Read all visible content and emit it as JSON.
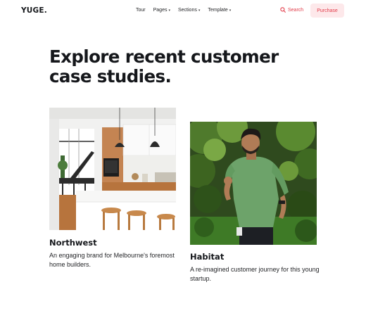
{
  "nav": {
    "logo": "YUGE.",
    "menu": [
      {
        "label": "Tour",
        "has_dropdown": false
      },
      {
        "label": "Pages",
        "has_dropdown": true
      },
      {
        "label": "Sections",
        "has_dropdown": true
      },
      {
        "label": "Template",
        "has_dropdown": true
      }
    ],
    "search_label": "Search",
    "search_icon": "search-icon",
    "purchase_label": "Purchase",
    "accent_color": "#e23b49",
    "purchase_bg_color": "#fde8ea"
  },
  "hero": {
    "title": "Explore recent customer case studies."
  },
  "cards": [
    {
      "name": "Northwest",
      "description": "An engaging brand for Melbourne's foremost home builders.",
      "image": "kitchen-interior-photo"
    },
    {
      "name": "Habitat",
      "description": "A re-imagined customer journey for this young startup.",
      "image": "man-in-green-shirt-photo"
    }
  ]
}
